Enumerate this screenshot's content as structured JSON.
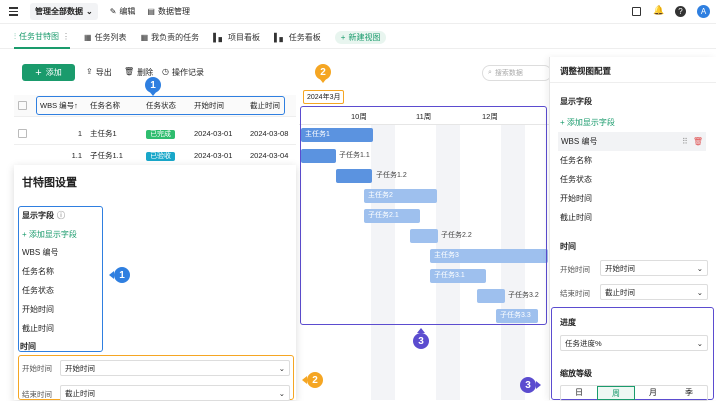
{
  "topbar": {
    "view_select": "管理全部数据",
    "edit": "编辑",
    "data_manage": "数据管理",
    "avatar": "A"
  },
  "tabs": [
    {
      "label": "任务甘特图",
      "active": true
    },
    {
      "label": "任务列表"
    },
    {
      "label": "我负责的任务"
    },
    {
      "label": "项目看板"
    },
    {
      "label": "任务看板"
    },
    {
      "label": "新建视图"
    }
  ],
  "toolbar": {
    "add": "添加",
    "export": "导出",
    "delete": "删除",
    "log": "操作记录",
    "search_placeholder": "搜索数据"
  },
  "table": {
    "headers": [
      "WBS 编号↑",
      "任务名称",
      "任务状态",
      "开始时间",
      "截止时间"
    ],
    "rows": [
      {
        "wbs": "1",
        "name": "主任务1",
        "status": "已完成",
        "start": "2024-03-01",
        "end": "2024-03-08"
      },
      {
        "wbs": "1.1",
        "name": "子任务1.1",
        "status": "已验收",
        "start": "2024-03-01",
        "end": "2024-03-04"
      }
    ]
  },
  "gantt": {
    "month": "2024年3月",
    "weeks": [
      "10周",
      "11周",
      "12周"
    ],
    "tasks": [
      "主任务1",
      "子任务1.1",
      "子任务1.2",
      "主任务2",
      "子任务2.1",
      "子任务2.2",
      "主任务3",
      "子任务3.1",
      "子任务3.2",
      "子任务3.3"
    ]
  },
  "left_panel": {
    "title": "甘特图设置",
    "display_fields_label": "显示字段",
    "add_field": "添加显示字段",
    "fields": [
      "WBS 编号",
      "任务名称",
      "任务状态",
      "开始时间",
      "截止时间"
    ],
    "time_label": "时间",
    "start_label": "开始时间",
    "start_value": "开始时间",
    "end_label": "结束时间",
    "end_value": "截止时间"
  },
  "right_panel": {
    "title": "调整视图配置",
    "display_fields_label": "显示字段",
    "add_field": "添加显示字段",
    "fields": [
      "WBS 编号",
      "任务名称",
      "任务状态",
      "开始时间",
      "截止时间"
    ],
    "time_label": "时间",
    "start_label": "开始时间",
    "start_value": "开始时间",
    "end_label": "结束时间",
    "end_value": "截止时间",
    "progress_label": "进度",
    "progress_value": "任务进度%",
    "zoom_label": "缩放等级",
    "zoom_options": [
      "日",
      "周",
      "月",
      "季"
    ],
    "zoom_selected": "周"
  },
  "callouts": {
    "one": "1",
    "two": "2",
    "three": "3"
  },
  "colors": {
    "accent": "#1a9b6c",
    "blue": "#2f7fe0",
    "orange": "#f5a623",
    "purple": "#5b4ccf"
  }
}
